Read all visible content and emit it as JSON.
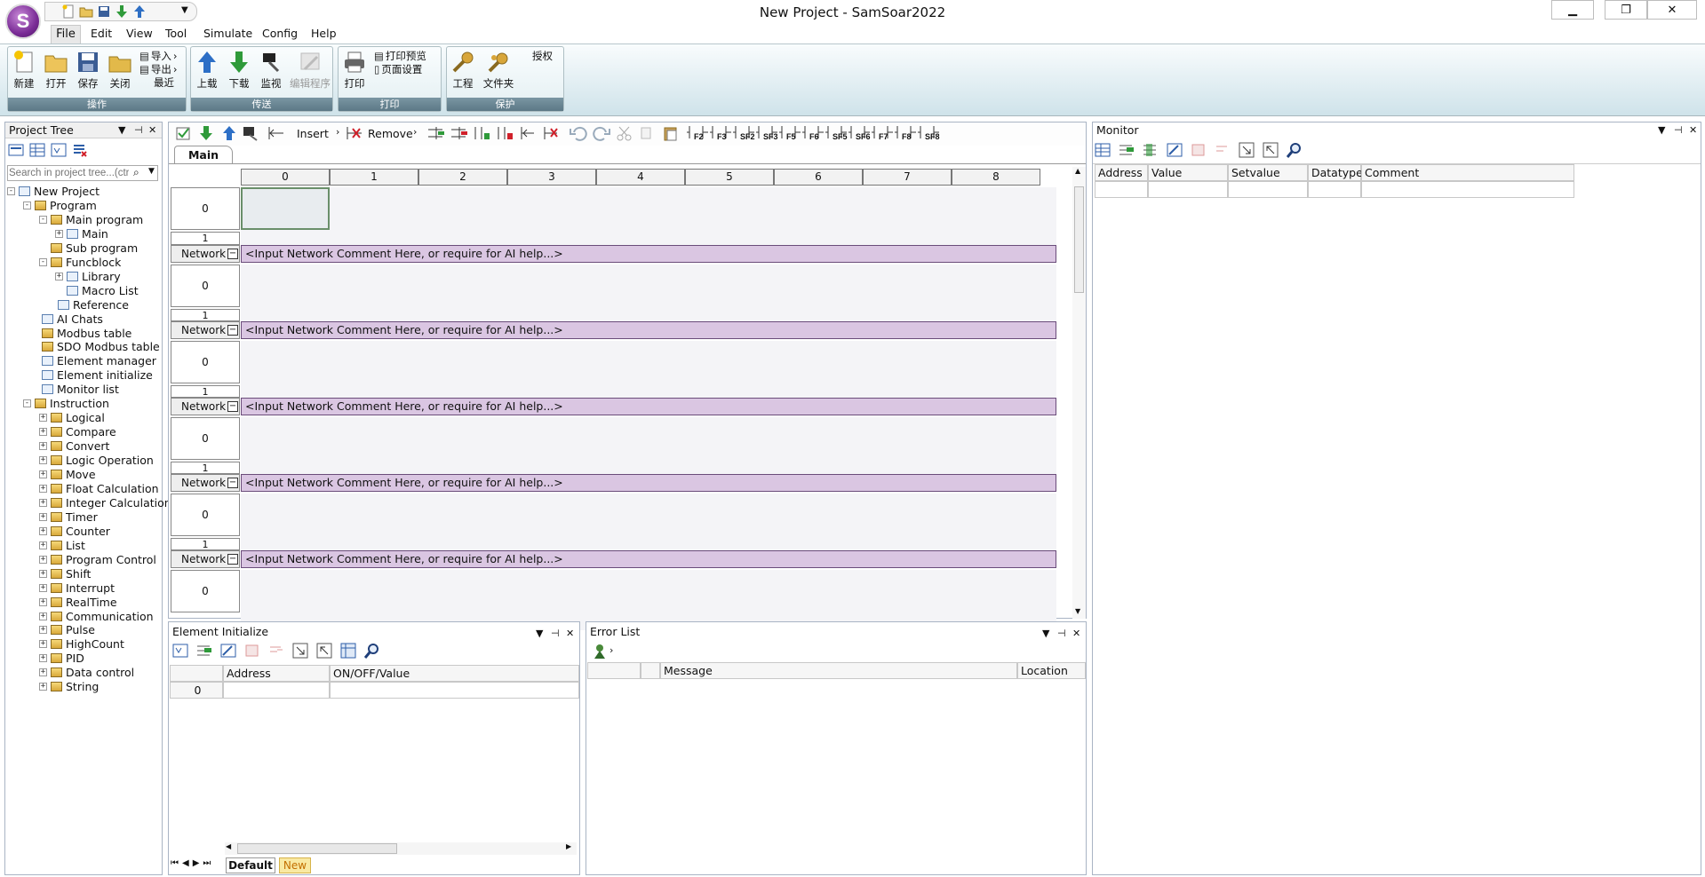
{
  "window": {
    "title": "New Project - SamSoar2022"
  },
  "app": {
    "logo_letter": "S"
  },
  "menu": [
    "File",
    "Edit",
    "View",
    "Tool",
    "Simulate",
    "Config",
    "Help"
  ],
  "ribbon": {
    "groups": [
      {
        "caption": "操作",
        "buttons": [
          "新建",
          "打开",
          "保存",
          "关闭"
        ],
        "small": [
          "导入",
          "导出",
          "最近"
        ]
      },
      {
        "caption": "传送",
        "buttons": [
          "上载",
          "下载",
          "监视",
          "编辑程序"
        ]
      },
      {
        "caption": "打印",
        "buttons": [
          "打印"
        ],
        "small": [
          "打印预览",
          "页面设置"
        ]
      },
      {
        "caption": "保护",
        "buttons": [
          "工程",
          "文件夹"
        ],
        "small": [
          "授权"
        ]
      }
    ]
  },
  "project_tree": {
    "title": "Project Tree",
    "search_placeholder": "Search in project tree...(ctrl+F)",
    "items": [
      "New Project",
      "Program",
      "Main program",
      "Main",
      "Sub program",
      "Funcblock",
      "Library",
      "Macro List",
      "Reference",
      "AI Chats",
      "Modbus table",
      "SDO Modbus table",
      "Element manager",
      "Element initialize",
      "Monitor list",
      "Instruction",
      "Logical",
      "Compare",
      "Convert",
      "Logic Operation",
      "Move",
      "Float Calculation",
      "Integer Calculation",
      "Timer",
      "Counter",
      "List",
      "Program Control",
      "Shift",
      "Interrupt",
      "RealTime",
      "Communication",
      "Pulse",
      "HighCount",
      "PID",
      "Data control",
      "String"
    ]
  },
  "editor": {
    "toolbar": {
      "insert": "Insert",
      "remove": "Remove",
      "fkeys": [
        "F2",
        "F3",
        "SF2",
        "SF3",
        "F5",
        "F6",
        "SF5",
        "SF6",
        "F7",
        "F8",
        "SF8"
      ]
    },
    "tab": "Main",
    "columns": [
      "0",
      "1",
      "2",
      "3",
      "4",
      "5",
      "6",
      "7",
      "8"
    ],
    "row0": "0",
    "row1": "1",
    "network_label": "Network",
    "network_comment": "<Input Network Comment Here, or require for AI help...>"
  },
  "monitor": {
    "title": "Monitor",
    "columns": [
      "Address",
      "Value",
      "Setvalue",
      "Datatype",
      "Comment"
    ]
  },
  "element_init": {
    "title": "Element Initialize",
    "columns": [
      "Address",
      "ON/OFF/Value"
    ],
    "row_index": "0",
    "sheet_tabs": [
      "Default",
      "New"
    ]
  },
  "error_list": {
    "title": "Error List",
    "columns": [
      "Message",
      "Location"
    ]
  },
  "colors": {
    "accent": "#7a2c96",
    "network_bar": "#dac6e2",
    "ribbon_caption": "#5c7886"
  }
}
